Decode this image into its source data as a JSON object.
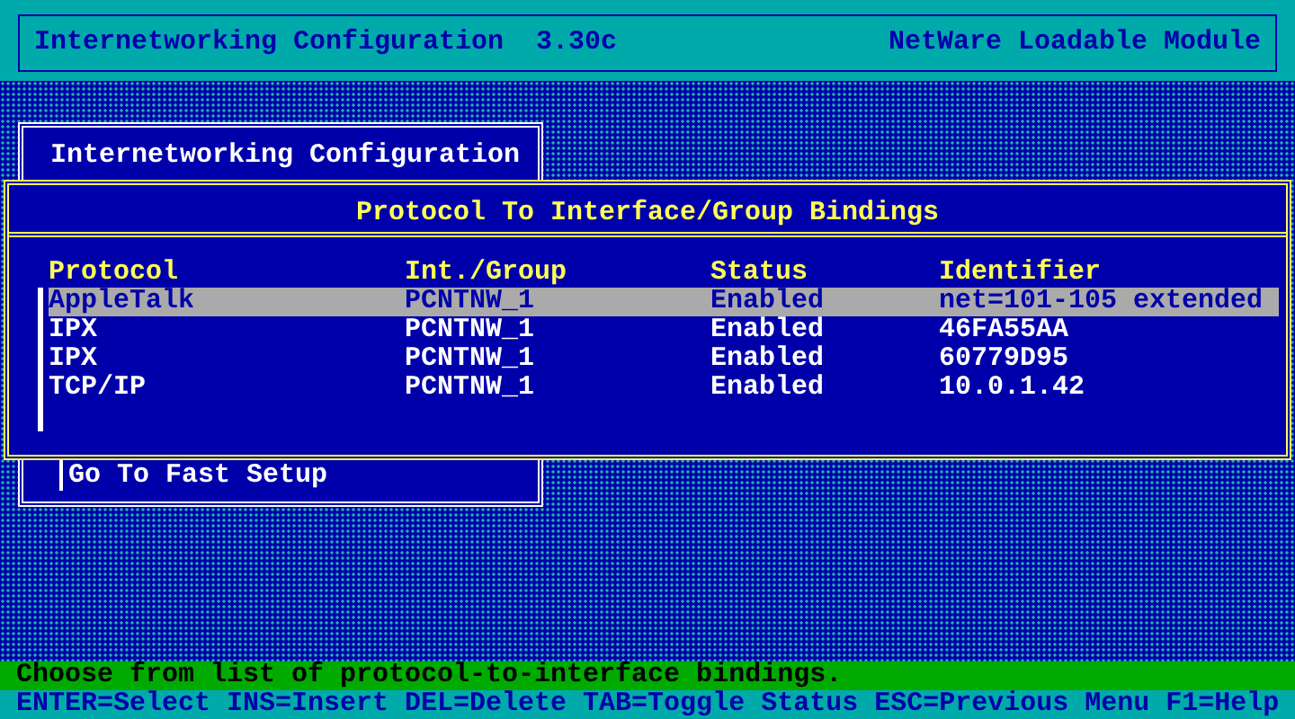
{
  "header": {
    "title": "Internetworking Configuration  3.30c",
    "module": "NetWare Loadable Module"
  },
  "menu": {
    "title": "Internetworking Configuration",
    "items": [
      {
        "label": "Go To Fast Setup"
      }
    ]
  },
  "bindings": {
    "title": "Protocol To Interface/Group Bindings",
    "columns": [
      "Protocol",
      "Int./Group",
      "Status",
      "Identifier"
    ],
    "rows": [
      {
        "protocol": "AppleTalk",
        "group": "PCNTNW_1",
        "status": "Enabled",
        "identifier": "net=101-105 extended",
        "selected": true
      },
      {
        "protocol": "IPX",
        "group": "PCNTNW_1",
        "status": "Enabled",
        "identifier": "46FA55AA",
        "selected": false
      },
      {
        "protocol": "IPX",
        "group": "PCNTNW_1",
        "status": "Enabled",
        "identifier": "60779D95",
        "selected": false
      },
      {
        "protocol": "TCP/IP",
        "group": "PCNTNW_1",
        "status": "Enabled",
        "identifier": "10.0.1.42",
        "selected": false
      }
    ]
  },
  "status_bar": {
    "message": "Choose from list of protocol-to-interface bindings.",
    "keys": "ENTER=Select INS=Insert DEL=Delete TAB=Toggle Status ESC=Previous Menu F1=Help"
  }
}
